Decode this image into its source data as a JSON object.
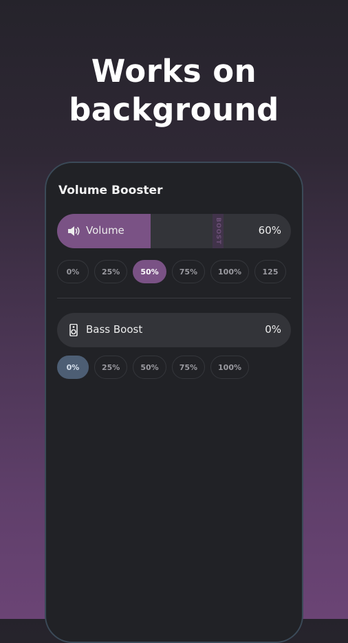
{
  "headline": {
    "line1": "Works on",
    "line2": "background"
  },
  "app": {
    "title": "Volume Booster"
  },
  "volume": {
    "label": "Volume",
    "value": "60%",
    "level": 0.4,
    "boost_label": "BOOST",
    "icon": "speaker-icon",
    "accent": "#7a5285",
    "presets": [
      "0%",
      "25%",
      "50%",
      "75%",
      "100%",
      "125"
    ],
    "selected": "50%"
  },
  "bass": {
    "label": "Bass Boost",
    "value": "0%",
    "level": 0,
    "icon": "speaker-box-icon",
    "accent": "#4d5e74",
    "presets": [
      "0%",
      "25%",
      "50%",
      "75%",
      "100%"
    ],
    "selected": "0%"
  }
}
